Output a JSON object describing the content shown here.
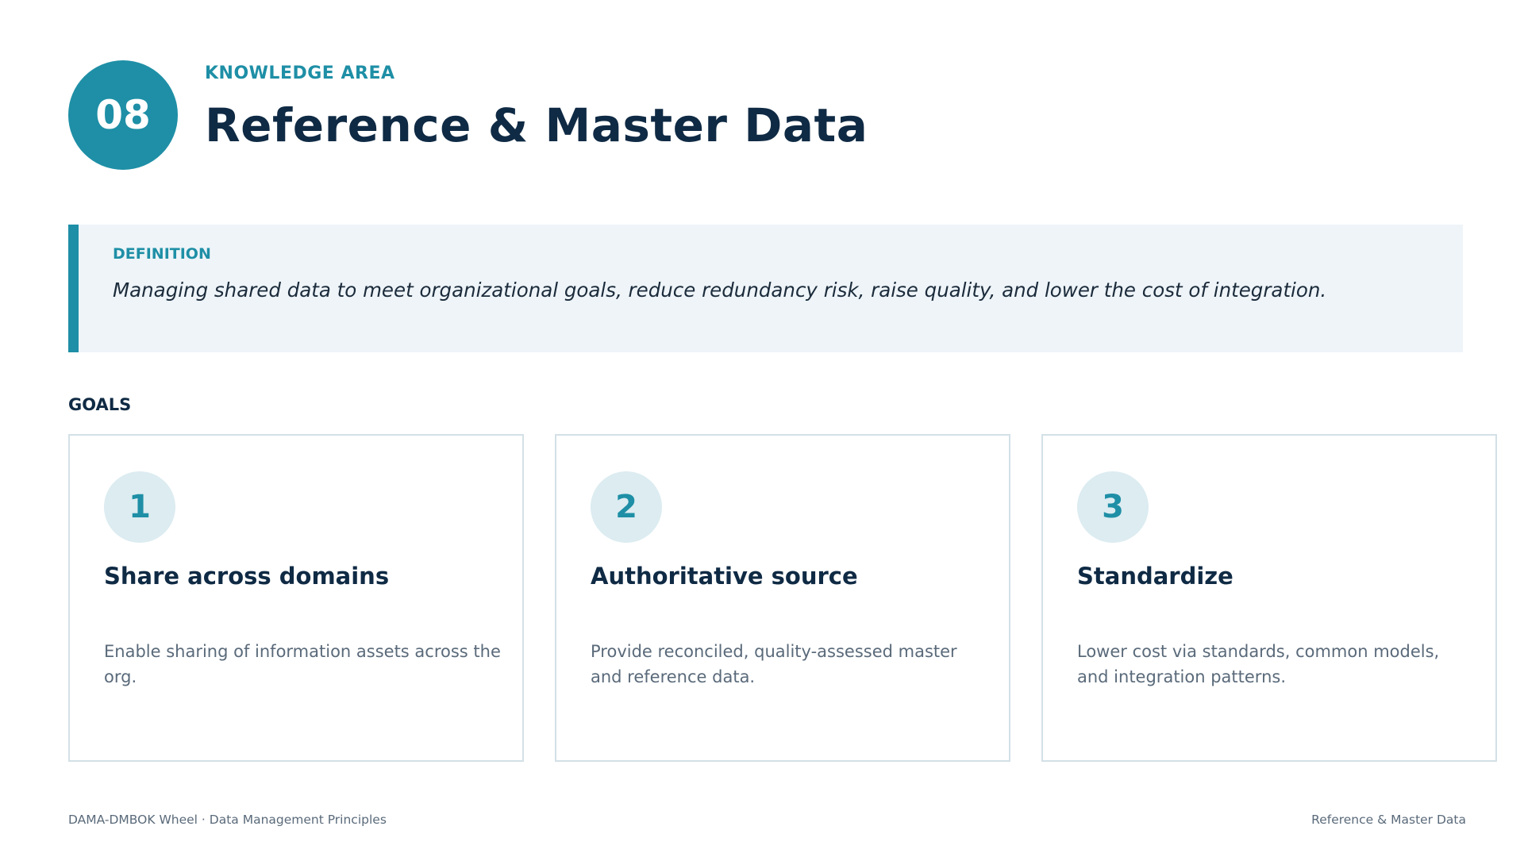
{
  "header": {
    "number": "08",
    "kicker": "KNOWLEDGE AREA",
    "title": "Reference & Master Data"
  },
  "definition": {
    "label": "DEFINITION",
    "text": "Managing shared data to meet organizational goals, reduce redundancy risk, raise quality, and lower the cost of integration."
  },
  "goals": {
    "label": "GOALS",
    "items": [
      {
        "number": "1",
        "title": "Share across domains",
        "description": "Enable sharing of information assets across the org."
      },
      {
        "number": "2",
        "title": "Authoritative source",
        "description": "Provide reconciled, quality-assessed master and reference data."
      },
      {
        "number": "3",
        "title": "Standardize",
        "description": "Lower cost via standards, common models, and integration patterns."
      }
    ]
  },
  "footer": {
    "left": "DAMA-DMBOK Wheel · Data Management Principles",
    "right": "Reference & Master Data"
  },
  "colors": {
    "accent": "#1e8fa6",
    "title": "#0f2a44",
    "definition_bg": "#eef4f8",
    "card_border": "#d3e0e7"
  }
}
